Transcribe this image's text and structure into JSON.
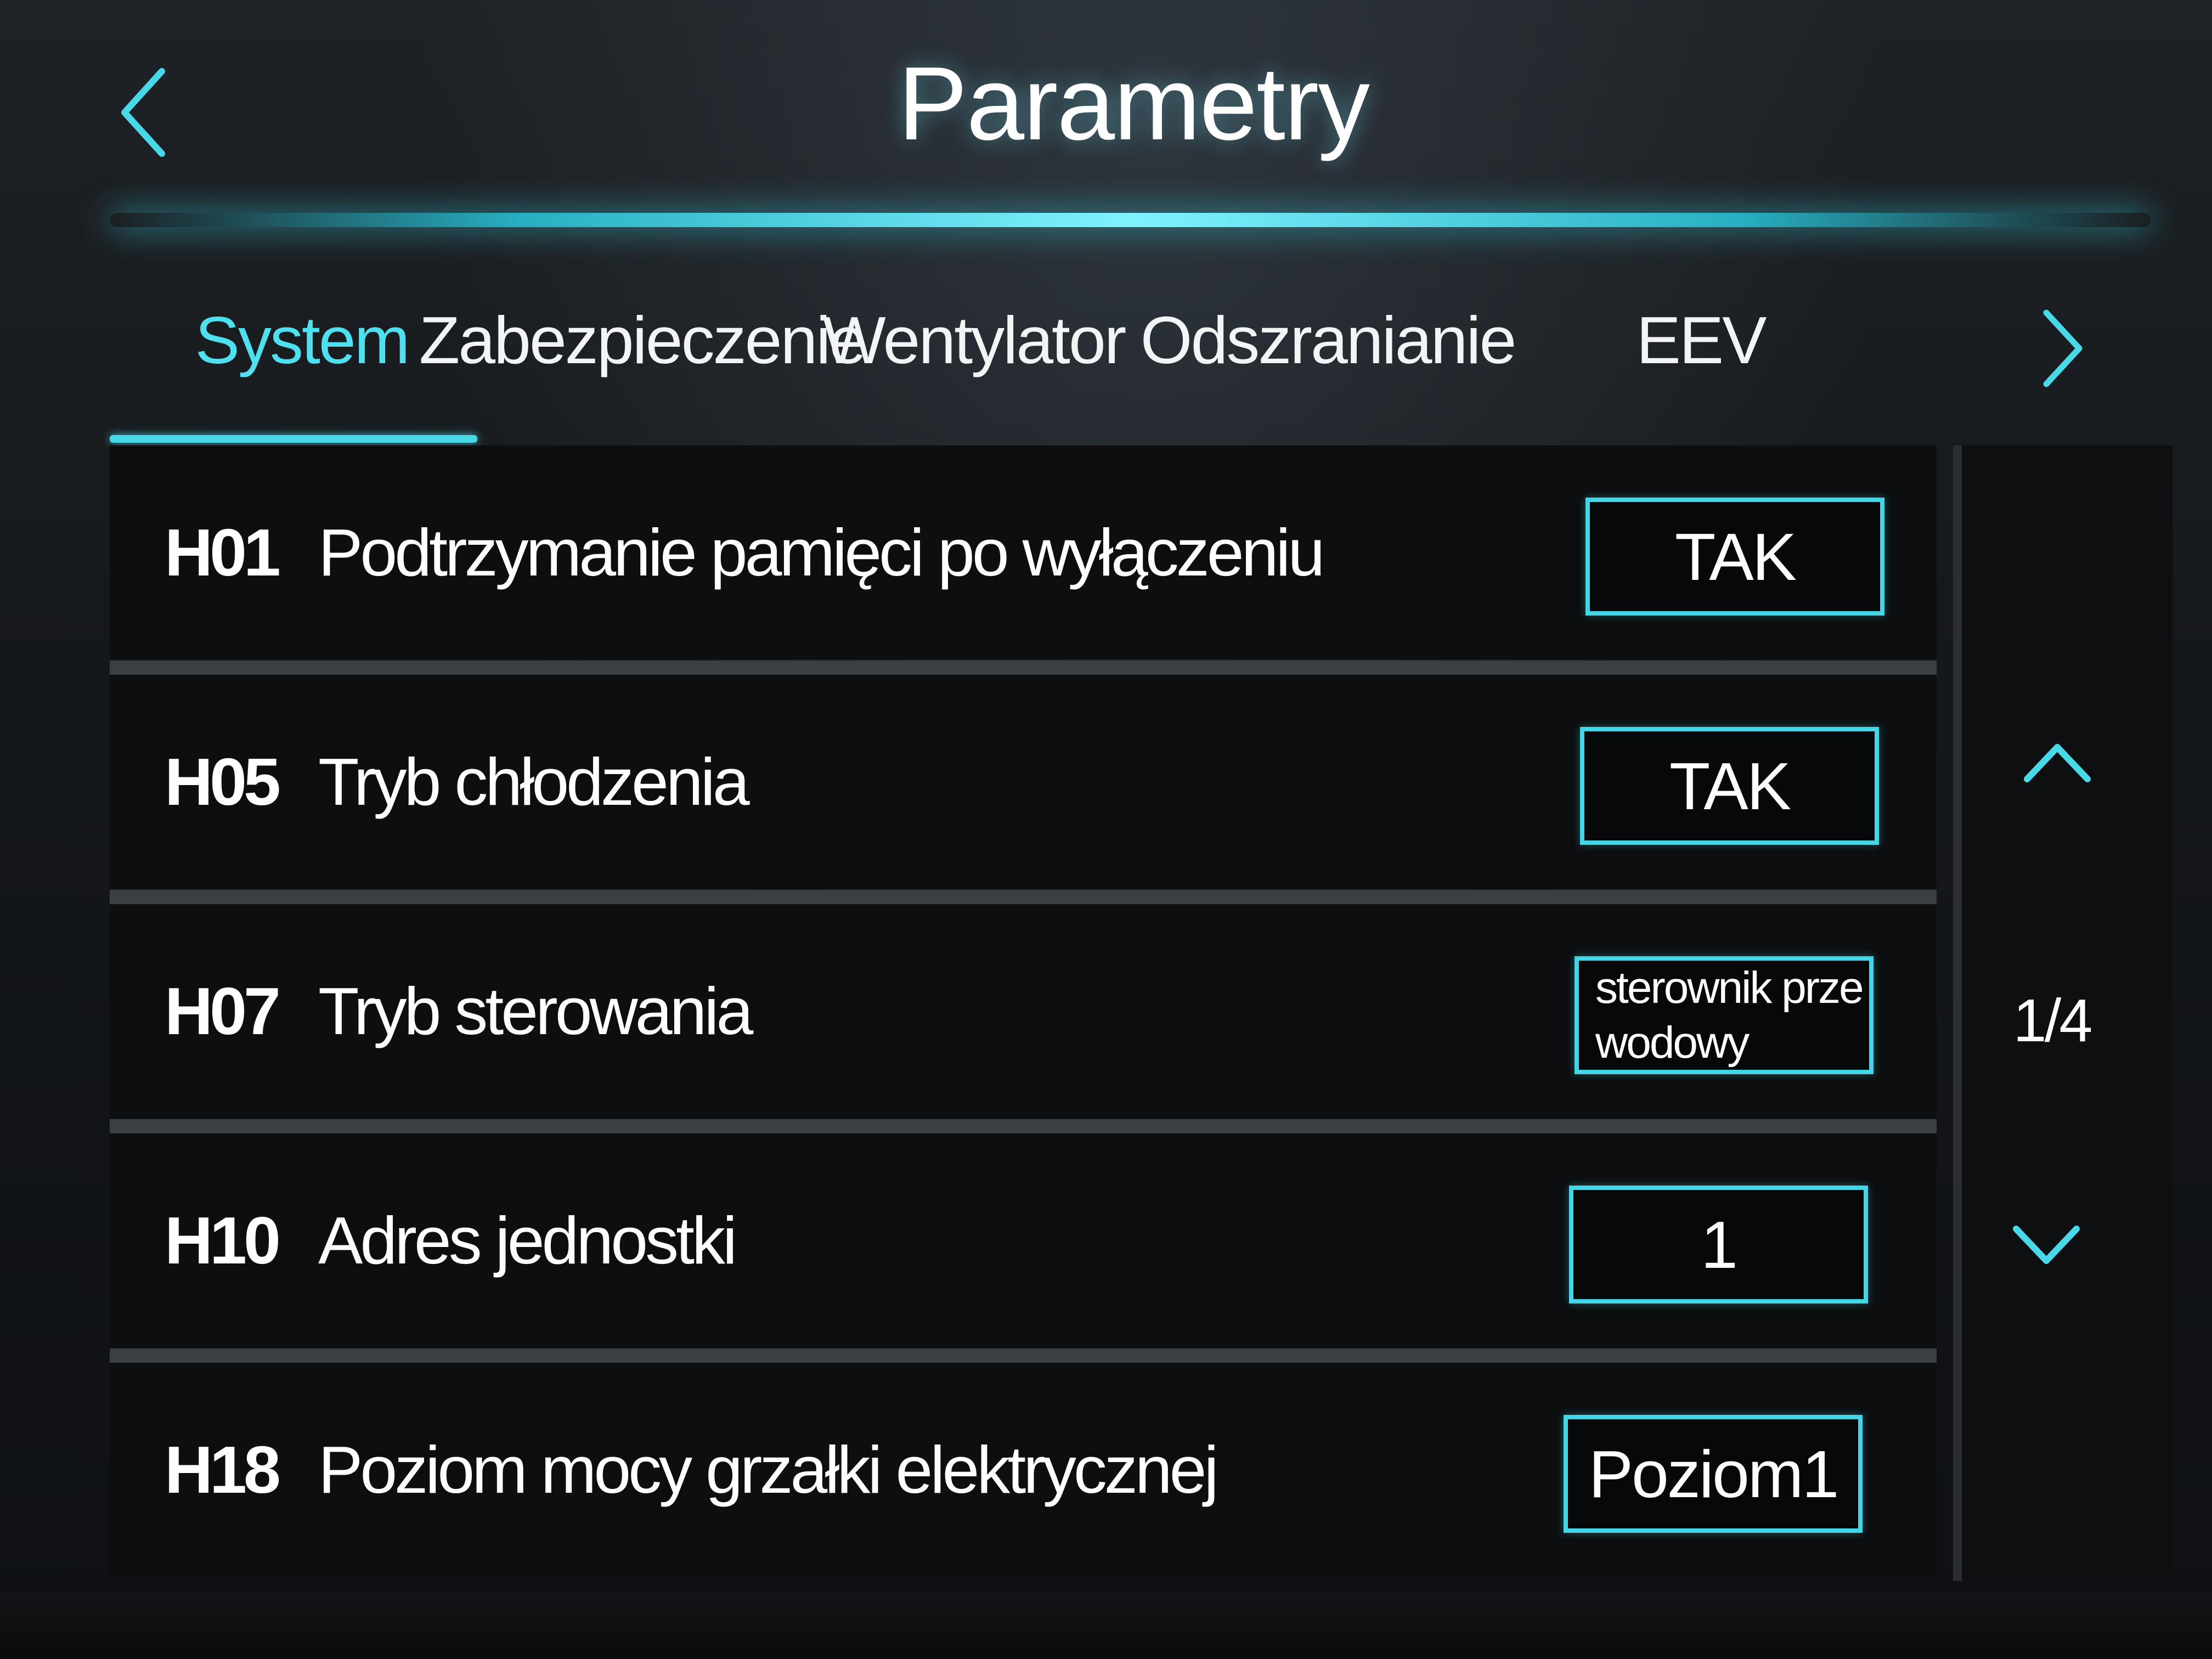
{
  "header": {
    "title": "Parametry"
  },
  "tabs": [
    {
      "label": "System",
      "active": true
    },
    {
      "label": "Zabezpieczenie",
      "active": false
    },
    {
      "label": "Wentylator",
      "active": false
    },
    {
      "label": "Odszranianie",
      "active": false
    },
    {
      "label": "EEV",
      "active": false
    }
  ],
  "parameters": [
    {
      "code": "H01",
      "label": "Podtrzymanie pamięci po wyłączeniu",
      "value": "TAK"
    },
    {
      "code": "H05",
      "label": "Tryb chłodzenia",
      "value": "TAK"
    },
    {
      "code": "H07",
      "label": "Tryb sterowania",
      "value_line1": "sterownik prze",
      "value_line2": "wodowy"
    },
    {
      "code": "H10",
      "label": "Adres jednostki",
      "value": "1"
    },
    {
      "code": "H18",
      "label": "Poziom mocy grzałki elektrycznej",
      "value": "Poziom1"
    }
  ],
  "pager": {
    "page": "1/4"
  },
  "colors": {
    "accent": "#48d8e8",
    "background": "#0c0e10",
    "text": "#ffffff"
  },
  "icons": {
    "back": "chevron-left-icon",
    "tabs_next": "chevron-right-icon",
    "page_up": "chevron-up-icon",
    "page_down": "chevron-down-icon"
  }
}
